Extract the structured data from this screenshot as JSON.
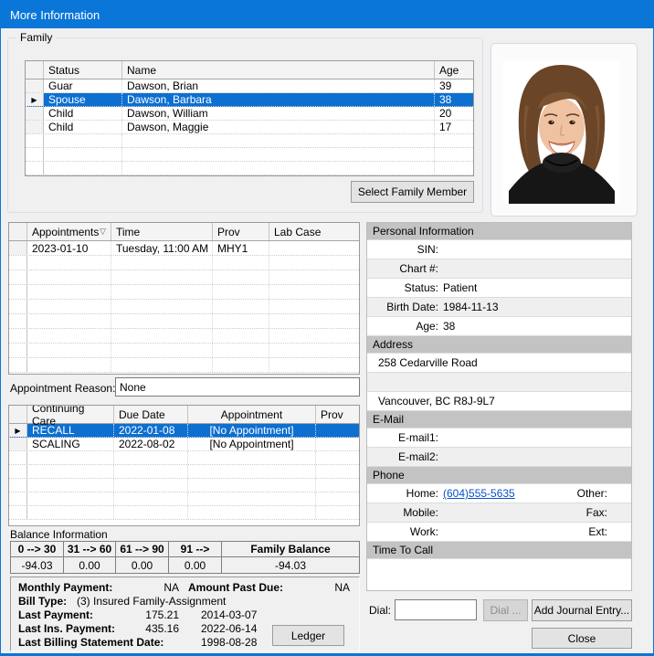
{
  "window": {
    "title": "More Information"
  },
  "colors": {
    "titlebar": "#0a76d8",
    "selection": "#0d6fd0",
    "section_header": "#c3c3c3",
    "link": "#0b50c8"
  },
  "family": {
    "group_label": "Family",
    "columns": [
      "Status",
      "Name",
      "Age"
    ],
    "rows": [
      {
        "status": "Guar",
        "name": "Dawson, Brian",
        "age": "39"
      },
      {
        "status": "Spouse",
        "name": "Dawson, Barbara",
        "age": "38"
      },
      {
        "status": "Child",
        "name": "Dawson, William",
        "age": "20"
      },
      {
        "status": "Child",
        "name": "Dawson, Maggie",
        "age": "17"
      }
    ],
    "select_button": "Select Family Member"
  },
  "appointments": {
    "columns": [
      "Appointments",
      "Time",
      "Prov",
      "Lab Case"
    ],
    "sort_glyph": "▽",
    "rows": [
      {
        "date": "2023-01-10",
        "time": "Tuesday, 11:00 AM",
        "prov": "MHY1",
        "lab_case": ""
      }
    ],
    "reason_label": "Appointment Reason:",
    "reason_value": "None"
  },
  "continuing_care": {
    "columns": [
      "Continuing Care",
      "Due Date",
      "Appointment",
      "Prov"
    ],
    "rows": [
      {
        "type": "RECALL",
        "due": "2022-01-08",
        "appointment": "[No Appointment]",
        "prov": ""
      },
      {
        "type": "SCALING",
        "due": "2022-08-02",
        "appointment": "[No Appointment]",
        "prov": ""
      }
    ]
  },
  "balance": {
    "section_label": "Balance Information",
    "columns": [
      "0 --> 30",
      "31 --> 60",
      "61 --> 90",
      "91 -->",
      "Family Balance"
    ],
    "values": [
      "-94.03",
      "0.00",
      "0.00",
      "0.00",
      "-94.03"
    ],
    "monthly_payment_label": "Monthly Payment:",
    "monthly_payment": "NA",
    "amount_past_due_label": "Amount Past Due:",
    "amount_past_due": "NA",
    "bill_type_label": "Bill Type:",
    "bill_type": "(3) Insured Family-Assignment",
    "last_payment_label": "Last Payment:",
    "last_payment_amount": "175.21",
    "last_payment_date": "2014-03-07",
    "last_ins_payment_label": "Last Ins. Payment:",
    "last_ins_payment_amount": "435.16",
    "last_ins_payment_date": "2022-06-14",
    "last_billing_label": "Last Billing Statement Date:",
    "last_billing_date": "1998-08-28",
    "ledger_button": "Ledger"
  },
  "personal": {
    "header": "Personal Information",
    "sin_label": "SIN:",
    "sin": "",
    "chart_label": "Chart #:",
    "chart": "",
    "status_label": "Status:",
    "status": "Patient",
    "birth_label": "Birth Date:",
    "birth": "1984-11-13",
    "age_label": "Age:",
    "age": "38",
    "address_header": "Address",
    "address1": "258 Cedarville Road",
    "address2": "",
    "city": "Vancouver, BC R8J-9L7",
    "email_header": "E-Mail",
    "email1_label": "E-mail1:",
    "email1": "",
    "email2_label": "E-mail2:",
    "email2": "",
    "phone_header": "Phone",
    "home_label": "Home:",
    "home": "(604)555-5635",
    "other_label": "Other:",
    "other": "",
    "mobile_label": "Mobile:",
    "mobile": "",
    "fax_label": "Fax:",
    "fax": "",
    "work_label": "Work:",
    "work": "",
    "ext_label": "Ext:",
    "ext": "",
    "time_to_call_header": "Time To Call"
  },
  "actions": {
    "dial_label": "Dial:",
    "dial_value": "",
    "dial_button": "Dial ...",
    "add_journal_button": "Add Journal Entry...",
    "close_button": "Close"
  }
}
